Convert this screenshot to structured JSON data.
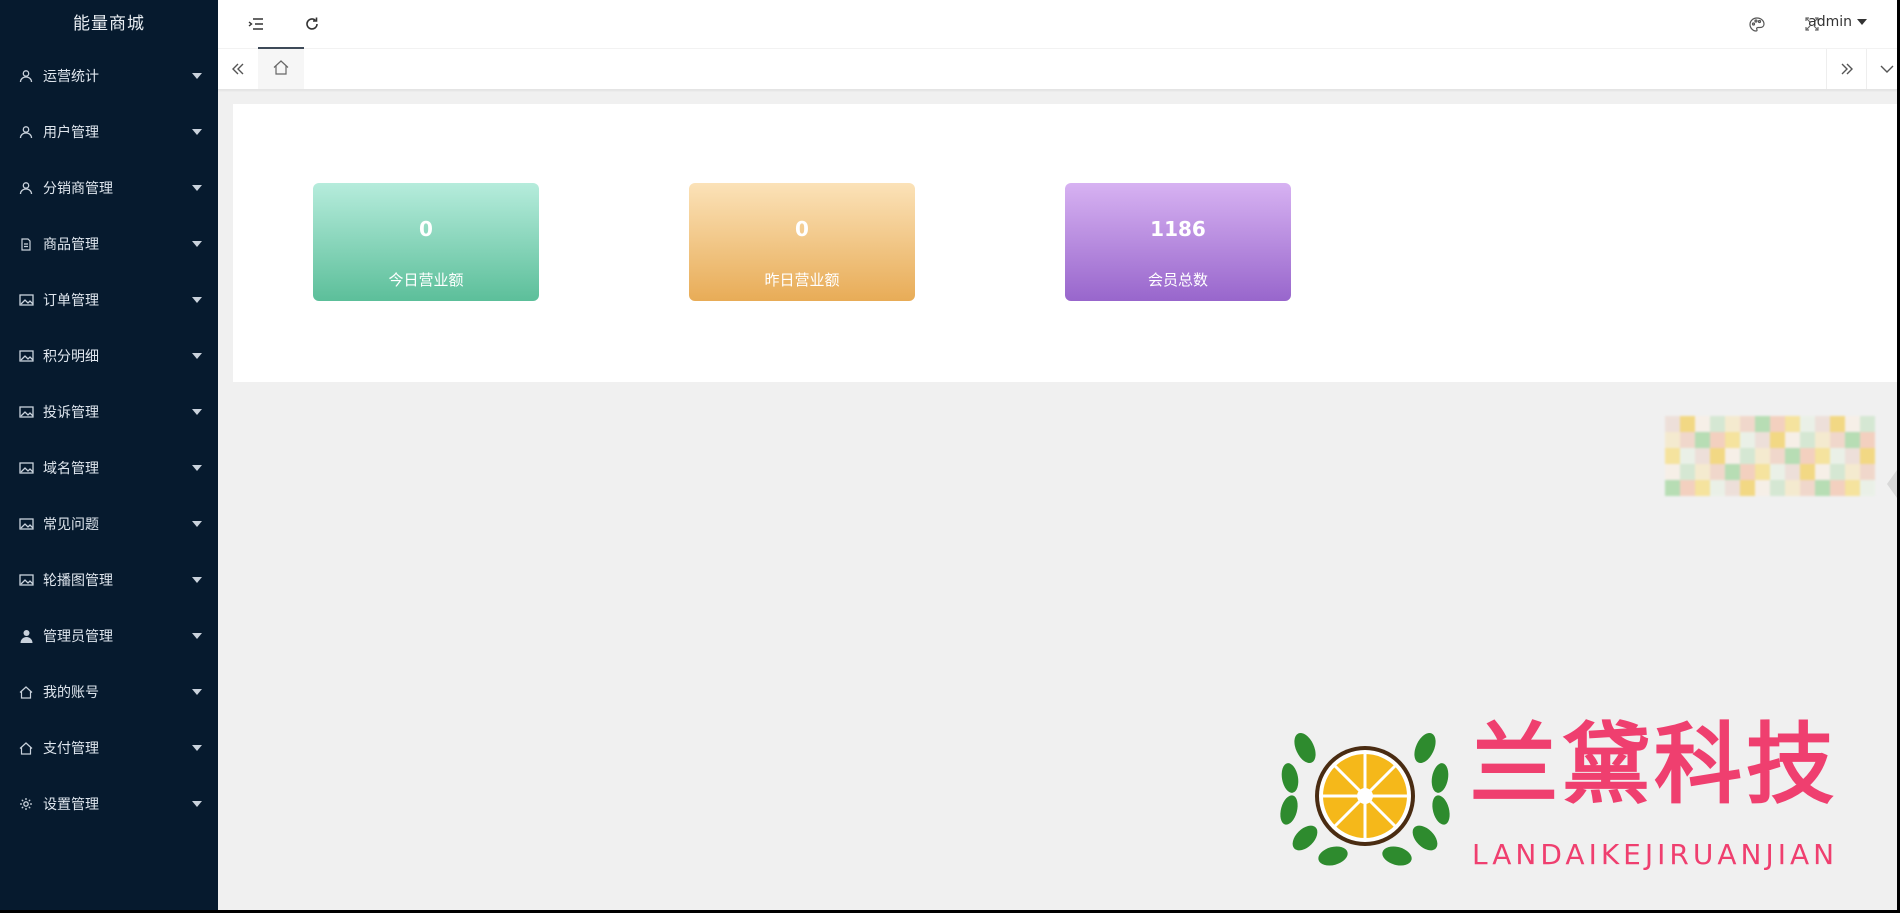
{
  "app": {
    "title": "能量商城"
  },
  "sidebar": {
    "items": [
      {
        "label": "运营统计",
        "icon": "user-icon"
      },
      {
        "label": "用户管理",
        "icon": "user-icon"
      },
      {
        "label": "分销商管理",
        "icon": "user-icon"
      },
      {
        "label": "商品管理",
        "icon": "document-icon"
      },
      {
        "label": "订单管理",
        "icon": "image-icon"
      },
      {
        "label": "积分明细",
        "icon": "image-icon"
      },
      {
        "label": "投诉管理",
        "icon": "image-icon"
      },
      {
        "label": "域名管理",
        "icon": "image-icon"
      },
      {
        "label": "常见问题",
        "icon": "image-icon"
      },
      {
        "label": "轮播图管理",
        "icon": "image-icon"
      },
      {
        "label": "管理员管理",
        "icon": "person-solid-icon"
      },
      {
        "label": "我的账号",
        "icon": "home-icon"
      },
      {
        "label": "支付管理",
        "icon": "home-icon"
      },
      {
        "label": "设置管理",
        "icon": "gear-icon"
      }
    ]
  },
  "header": {
    "user": "admin",
    "icons": [
      "menu-toggle-icon",
      "refresh-icon",
      "palette-icon",
      "fullscreen-icon"
    ]
  },
  "tabs": {
    "home_icon": "home-icon",
    "prev_icon": "double-left-icon",
    "next_icon": "double-right-icon",
    "more_icon": "chevron-down-icon"
  },
  "stats": {
    "cards": [
      {
        "value": "0",
        "label": "今日营业额",
        "color": "#5cbf9a"
      },
      {
        "value": "0",
        "label": "昨日营业额",
        "color": "#e8ac57"
      },
      {
        "value": "1186",
        "label": "会员总数",
        "color": "#9866cc"
      }
    ]
  },
  "watermark": {
    "cn": "兰黛科技",
    "en": "LANDAIKEJIRUANJIAN",
    "color": "#ef3f6f"
  }
}
